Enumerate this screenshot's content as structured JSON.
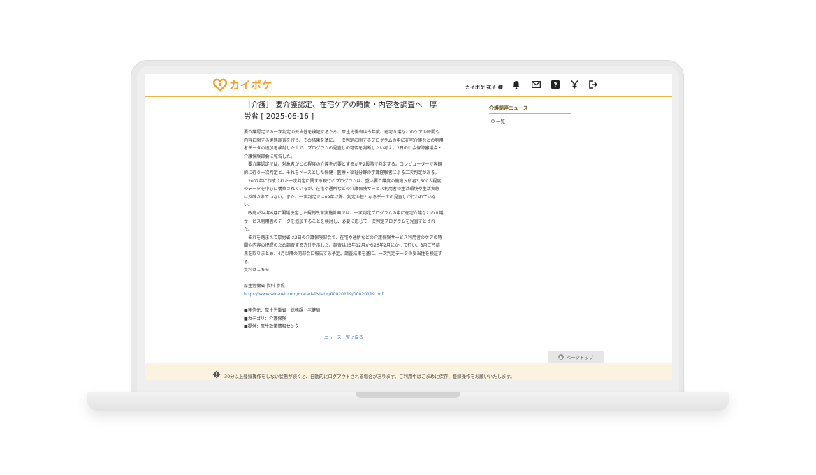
{
  "header": {
    "logo_text": "カイポケ",
    "user_name": "カイポケ 花子 様"
  },
  "header_icons": [
    "bell-icon",
    "mail-icon",
    "help-icon",
    "yen-icon",
    "logout-icon"
  ],
  "article": {
    "title": "［介護］ 要介護認定、在宅ケアの時間・内容を調査へ　厚労省 [ 2025-06-16 ]",
    "paragraphs": [
      "要介護認定での一次判定の妥当性を検証するため、厚生労働省は今年度、在宅介護などのケアの時間や内容に関する実態調査を行う。その結果を基に、一次判定に関するプログラムの中に在宅介護などの利用者データの追加を検討した上で、プログラムの見直しの可否を判断したい考え。2日の社会保障審議会・介護保険部会に報告した。",
      "要介護認定では、対象者がどの程度の介護を必要とするかを2段階で判定する。コンピューターで客観的に行う一次判定と、それをベースとした保健・医療・福祉分野の学識経験者による二次判定がある。",
      "2007年に作成された一次判定に関する現行のプログラムは、重い要介護度の施設入所者3,500人程度のデータを中心に構築されているが、在宅や通所などの介護保険サービス利用者の生活環境や生活実態は反映されていない。また、一次判定では09年以降、判定の基となるデータの見直しが行われていない。",
      "政府が24年6月に閣議決定した規制改革実施計画では、一次判定プログラムの中に在宅介護などの介護サービス利用者のデータを追加することを検討し、必要に応じて一次判定プログラムを見直すとされた。",
      "それを踏まえて厚労省は2日の介護保険部会で、在宅や通所などの介護保険サービス利用者のケアの時間や内容の把握のため調査する方針を示した。調査は25年12月から26年2月にかけて行い、3月ごろ結果を取りまとめ、4月以降の同部会に報告する予定。調査結果を基に、一次判定データの妥当性を検証する。"
    ],
    "material_line": "資料はこちら",
    "ref_label": "厚生労働省 資料 参照",
    "ref_url": "https://www.wic-net.com/material/static/00020119/00020119.pdf",
    "meta": [
      "■発信元：厚生労働省　総務課　老健局",
      "■カテゴリ：介護保険",
      "■提供：厚生政策情報センター"
    ],
    "back_link": "ニュース一覧に戻る"
  },
  "sidebar": {
    "title": "介護関連ニュース",
    "item": "一覧"
  },
  "page_top": "ページトップ",
  "notice": "30分以上登録操作をしない状態が続くと、自動的にログアウトされる場合があります。ご利用中はこまめに保存、登録操作をお願いいたします。"
}
